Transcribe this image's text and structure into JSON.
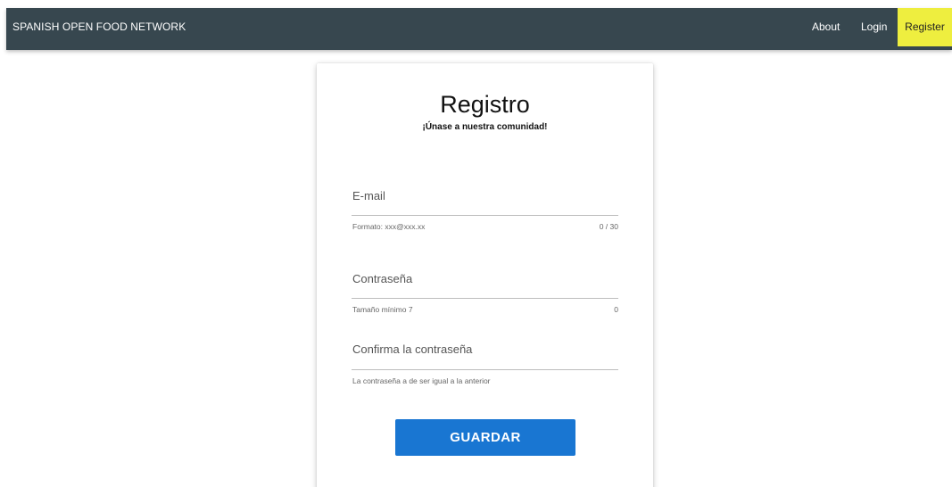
{
  "topbar": {
    "brand": "SPANISH OPEN FOOD NETWORK",
    "nav": {
      "about": "About",
      "login": "Login",
      "register": "Register"
    }
  },
  "form": {
    "title": "Registro",
    "subtitle": "¡Únase a nuestra comunidad!",
    "email": {
      "label": "E-mail",
      "hint": "Formato: xxx@xxx.xx",
      "counter": "0 / 30"
    },
    "password": {
      "label": "Contraseña",
      "hint": "Tamaño mínimo 7",
      "counter": "0"
    },
    "confirm": {
      "label": "Confirma la contraseña",
      "hint": "La contraseña a de ser igual a la anterior"
    },
    "submit": "GUARDAR"
  },
  "colors": {
    "topbar": "#37474f",
    "register_accent": "#eeee3f",
    "button": "#1976d2"
  }
}
